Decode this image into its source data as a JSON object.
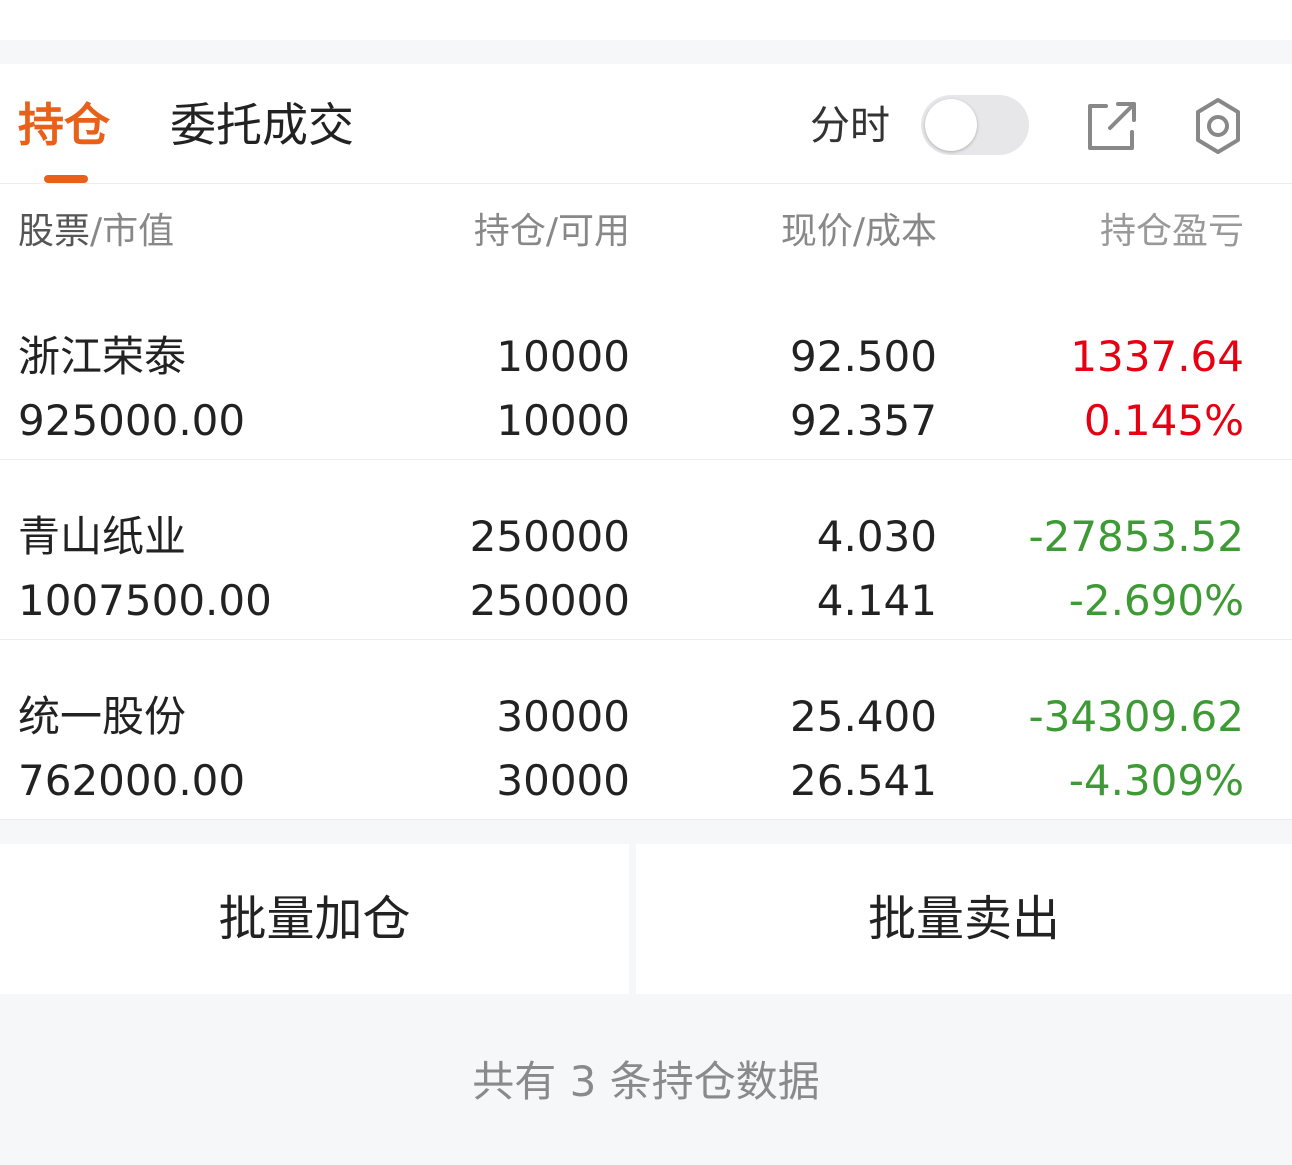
{
  "tabs": [
    {
      "label": "持仓",
      "active": true
    },
    {
      "label": "委托成交",
      "active": false
    }
  ],
  "controls": {
    "timeshare_label": "分时",
    "timeshare_on": false
  },
  "colors": {
    "accent": "#e8611a",
    "profit": "#e60012",
    "loss": "#3d9a35"
  },
  "table": {
    "headers": {
      "stock": "股票",
      "market_value": "市值",
      "position": "持仓",
      "available": "可用",
      "price": "现价",
      "cost": "成本",
      "pnl": "持仓盈亏"
    },
    "separator": "/",
    "rows": [
      {
        "name": "浙江荣泰",
        "market_value": "925000.00",
        "position": "10000",
        "available": "10000",
        "price": "92.500",
        "cost": "92.357",
        "pnl": "1337.64",
        "pnl_pct": "0.145%",
        "trend": "up"
      },
      {
        "name": "青山纸业",
        "market_value": "1007500.00",
        "position": "250000",
        "available": "250000",
        "price": "4.030",
        "cost": "4.141",
        "pnl": "-27853.52",
        "pnl_pct": "-2.690%",
        "trend": "down"
      },
      {
        "name": "统一股份",
        "market_value": "762000.00",
        "position": "30000",
        "available": "30000",
        "price": "25.400",
        "cost": "26.541",
        "pnl": "-34309.62",
        "pnl_pct": "-4.309%",
        "trend": "down"
      }
    ]
  },
  "actions": {
    "batch_add": "批量加仓",
    "batch_sell": "批量卖出"
  },
  "footer": {
    "summary": "共有 3 条持仓数据"
  },
  "icons": {
    "share": "share-external-icon",
    "settings": "gear-icon"
  }
}
